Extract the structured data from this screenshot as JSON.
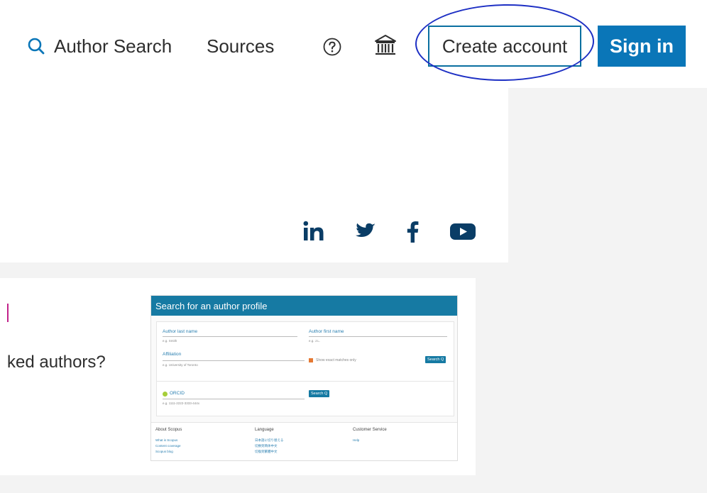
{
  "header": {
    "author_search_label": "Author Search",
    "sources_label": "Sources",
    "create_account_label": "Create account",
    "sign_in_label": "Sign in",
    "icons": [
      "search-icon",
      "help-icon",
      "institution-icon"
    ]
  },
  "colors": {
    "brand_blue": "#0a76b8",
    "annotation_ink": "#1d2fc4",
    "accent_pink": "#c2228a"
  },
  "social": {
    "icons": [
      "linkedin-icon",
      "twitter-icon",
      "facebook-icon",
      "youtube-icon"
    ]
  },
  "content": {
    "question_text": "ked authors?"
  },
  "preview": {
    "title": "Search for an author profile",
    "last_name_label": "Author last name",
    "last_name_hint": "e.g. Smith",
    "first_name_label": "Author first name",
    "first_name_hint": "e.g. J.L.",
    "affiliation_label": "Affiliation",
    "affiliation_hint": "e.g. University of Toronto",
    "exact_matches_label": "Show exact matches only",
    "search_button": "Search Q",
    "orcid_label": "ORCID",
    "orcid_hint": "e.g. 1111-2222-3333-444x",
    "orcid_search_button": "Search Q",
    "footer": {
      "about_heading": "About Scopus",
      "about_links": [
        "What is Scopus",
        "Content coverage",
        "Scopus blog"
      ],
      "language_heading": "Language",
      "language_links": [
        "日本語に切り替える",
        "切换到简体中文",
        "切換到繁體中文"
      ],
      "service_heading": "Customer Service",
      "service_links": [
        "Help"
      ]
    }
  }
}
